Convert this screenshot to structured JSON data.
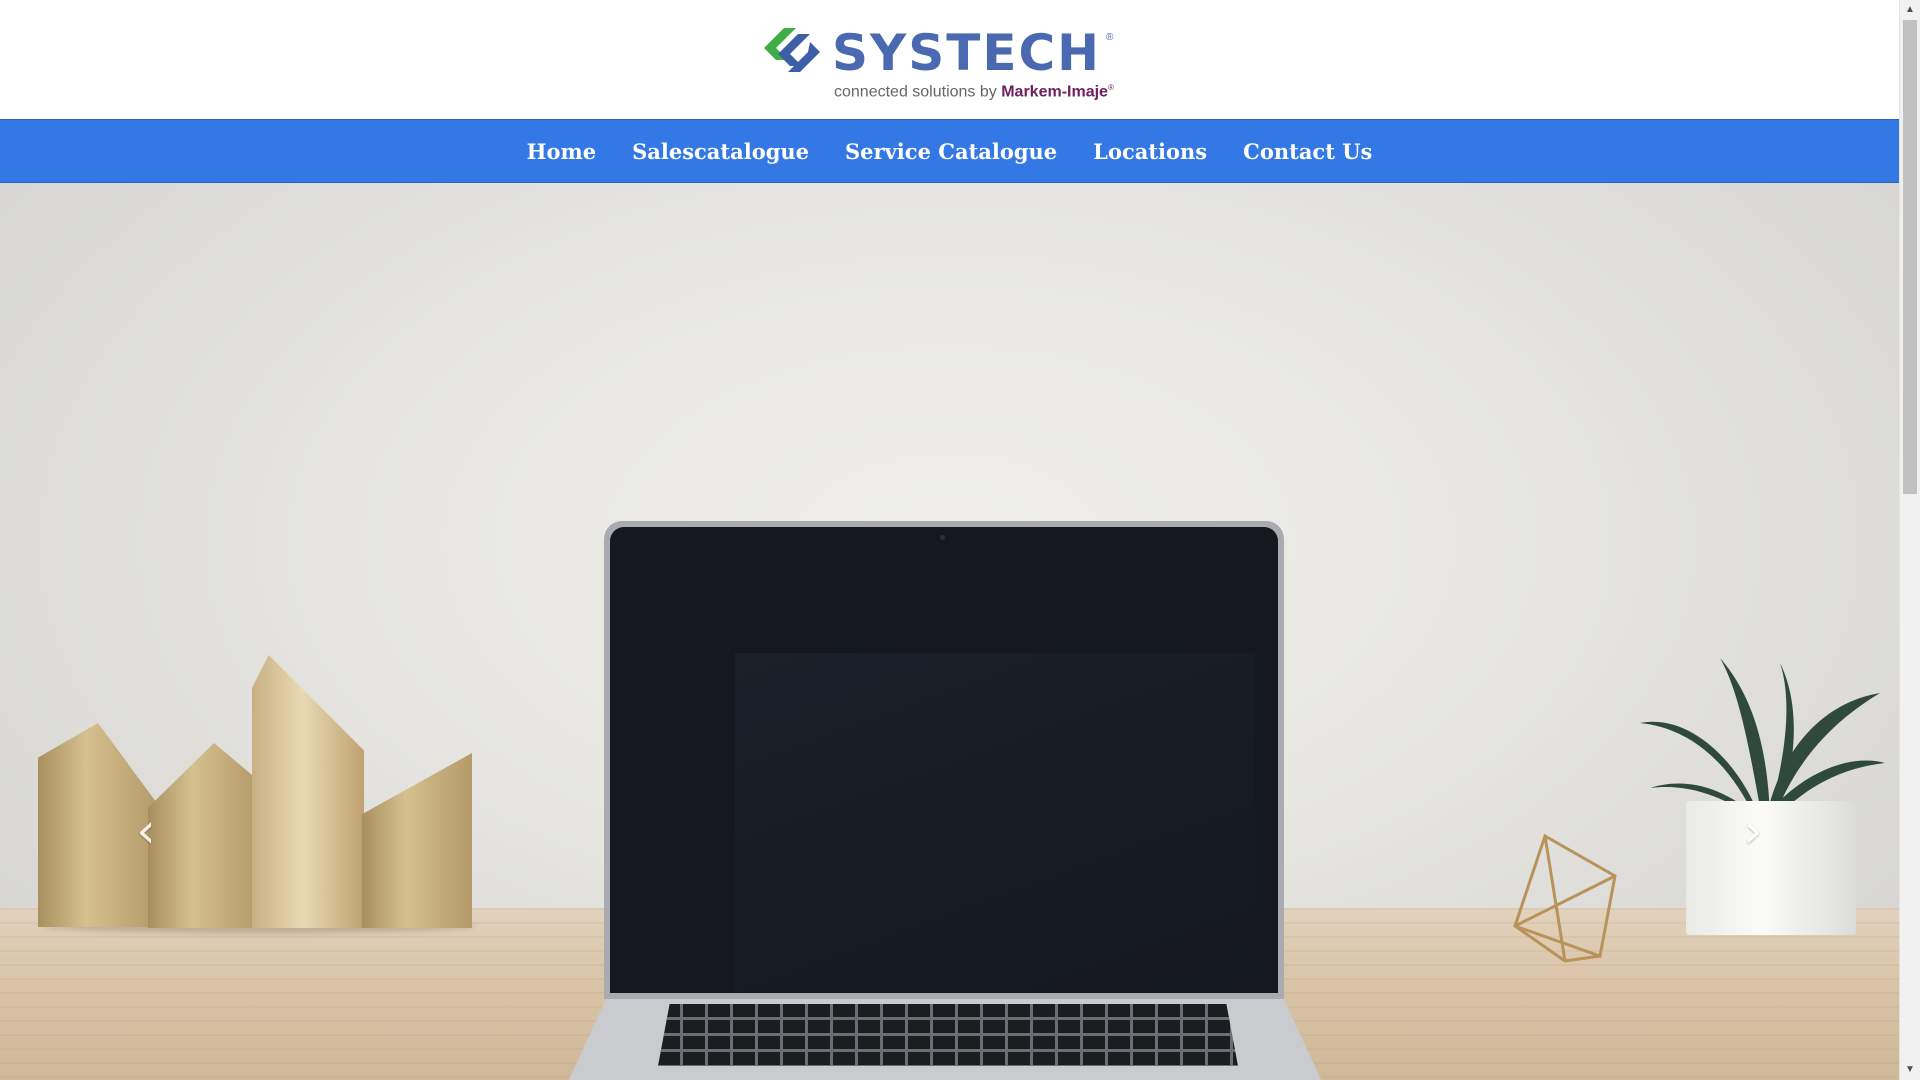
{
  "header": {
    "logo": {
      "wordmark": "SYSTECH",
      "registered": "®",
      "tagline_prefix": "connected solutions by ",
      "tagline_brand": "Markem-Imaje",
      "tagline_registered": "®",
      "colors": {
        "wordmark": "#4a69b0",
        "mark_green": "#3fae49",
        "mark_blue": "#3d5fa8",
        "brand": "#6d1f5e"
      }
    }
  },
  "nav": {
    "background": "#3478e5",
    "items": [
      {
        "label": "Home"
      },
      {
        "label": "Salescatalogue"
      },
      {
        "label": "Service Catalogue"
      },
      {
        "label": "Locations"
      },
      {
        "label": "Contact Us"
      }
    ]
  },
  "hero": {
    "prev_icon": "chevron-left-icon",
    "next_icon": "chevron-right-icon",
    "prev_glyph": "‹",
    "next_glyph": "›"
  },
  "scrollbar": {
    "up_glyph": "▲",
    "down_glyph": "▼"
  }
}
